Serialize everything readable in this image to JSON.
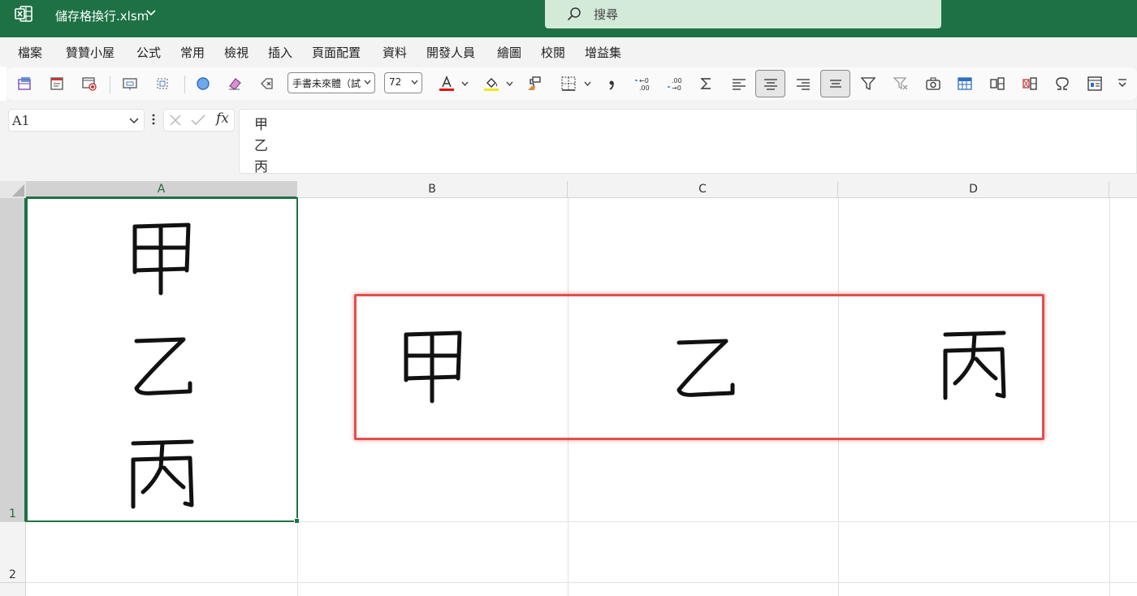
{
  "titlebar": {
    "filename": "儲存格換行.xlsm",
    "search_placeholder": "搜尋",
    "app_icon": "excel-icon",
    "accent": "#1e7145"
  },
  "menu": [
    "檔案",
    "贊贊小屋",
    "公式",
    "常用",
    "檢視",
    "插入",
    "頁面配置",
    "資料",
    "開發人員",
    "繪圖",
    "校閱",
    "增益集"
  ],
  "toolbar": {
    "font_name": "手書未來體（試",
    "font_size": "72"
  },
  "formula_bar": {
    "name_box": "A1",
    "fx_label": "fx",
    "content_lines": [
      "甲",
      "乙",
      "丙"
    ]
  },
  "sheet": {
    "columns": [
      "A",
      "B",
      "C",
      "D"
    ],
    "rows": [
      "1",
      "2"
    ],
    "cells": {
      "A1": [
        "甲",
        "乙",
        "丙"
      ],
      "B_highlight": "甲",
      "C_highlight": "乙",
      "D_highlight": "丙"
    },
    "active_cell": "A1",
    "highlight_color": "#e0504e"
  }
}
